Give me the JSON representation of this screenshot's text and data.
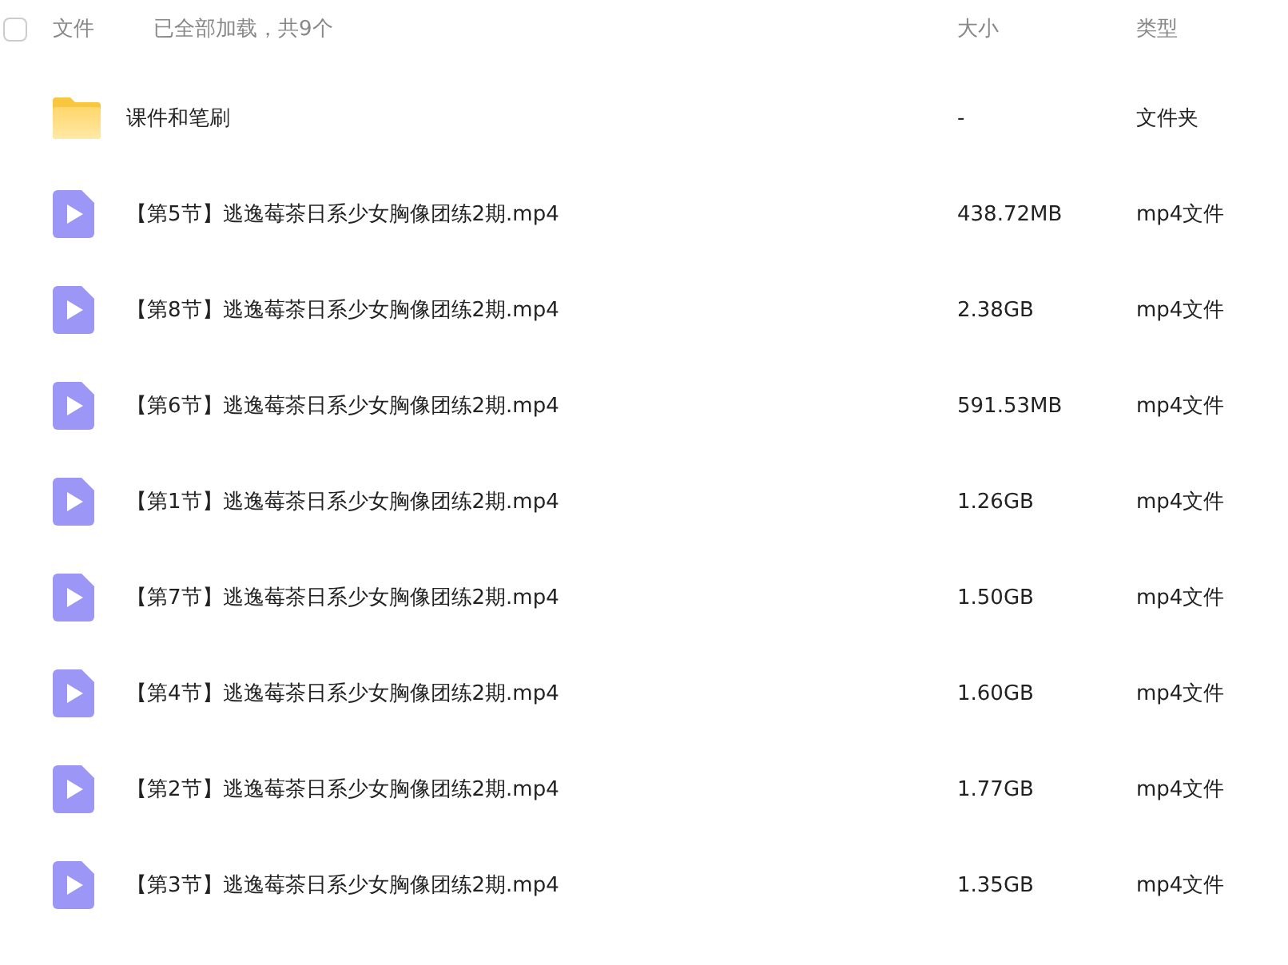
{
  "header": {
    "select_all": {
      "checked": false
    },
    "name_column": "文件",
    "load_status": "已全部加载，共9个",
    "size_column": "大小",
    "type_column": "类型"
  },
  "files": [
    {
      "kind": "folder",
      "name": "课件和笔刷",
      "size": "-",
      "type": "文件夹"
    },
    {
      "kind": "video",
      "name": "【第5节】逃逸莓茶日系少女胸像团练2期.mp4",
      "size": "438.72MB",
      "type": "mp4文件"
    },
    {
      "kind": "video",
      "name": "【第8节】逃逸莓茶日系少女胸像团练2期.mp4",
      "size": "2.38GB",
      "type": "mp4文件"
    },
    {
      "kind": "video",
      "name": "【第6节】逃逸莓茶日系少女胸像团练2期.mp4",
      "size": "591.53MB",
      "type": "mp4文件"
    },
    {
      "kind": "video",
      "name": "【第1节】逃逸莓茶日系少女胸像团练2期.mp4",
      "size": "1.26GB",
      "type": "mp4文件"
    },
    {
      "kind": "video",
      "name": "【第7节】逃逸莓茶日系少女胸像团练2期.mp4",
      "size": "1.50GB",
      "type": "mp4文件"
    },
    {
      "kind": "video",
      "name": "【第4节】逃逸莓茶日系少女胸像团练2期.mp4",
      "size": "1.60GB",
      "type": "mp4文件"
    },
    {
      "kind": "video",
      "name": "【第2节】逃逸莓茶日系少女胸像团练2期.mp4",
      "size": "1.77GB",
      "type": "mp4文件"
    },
    {
      "kind": "video",
      "name": "【第3节】逃逸莓茶日系少女胸像团练2期.mp4",
      "size": "1.35GB",
      "type": "mp4文件"
    }
  ]
}
